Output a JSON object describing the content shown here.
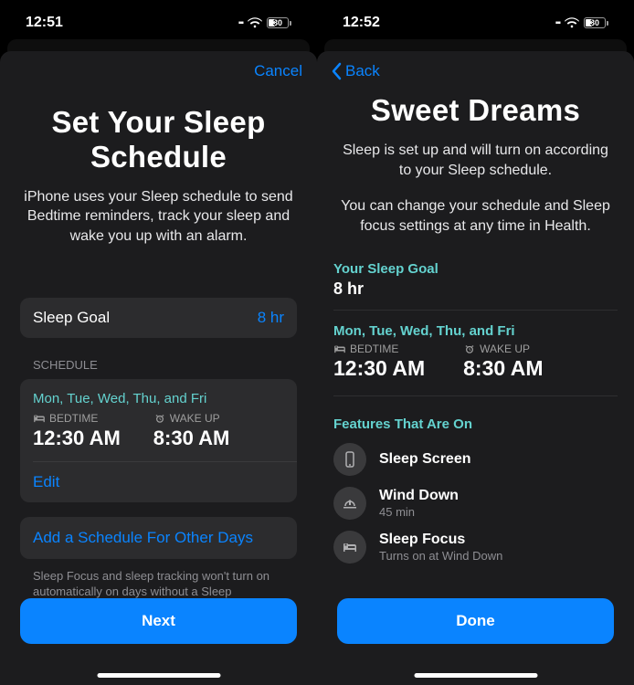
{
  "left": {
    "status_time": "12:51",
    "battery": "30",
    "cancel": "Cancel",
    "title_line1": "Set Your Sleep",
    "title_line2": "Schedule",
    "subtitle": "iPhone uses your Sleep schedule to send Bedtime reminders, track your sleep and wake you up with an alarm.",
    "sleep_goal_label": "Sleep Goal",
    "sleep_goal_value": "8 hr",
    "schedule_header": "SCHEDULE",
    "days": "Mon, Tue, Wed, Thu, and Fri",
    "bedtime_label": "BEDTIME",
    "bedtime_value": "12:30 AM",
    "wakeup_label": "WAKE UP",
    "wakeup_value": "8:30 AM",
    "edit": "Edit",
    "add_schedule": "Add a Schedule For Other Days",
    "footer": "Sleep Focus and sleep tracking won't turn on automatically on days without a Sleep schedule.",
    "next": "Next"
  },
  "right": {
    "status_time": "12:52",
    "battery": "30",
    "back": "Back",
    "title": "Sweet Dreams",
    "subtitle1": "Sleep is set up and will turn on according to your Sleep schedule.",
    "subtitle2": "You can change your schedule and Sleep focus settings at any time in Health.",
    "goal_label": "Your Sleep Goal",
    "goal_value": "8 hr",
    "days": "Mon, Tue, Wed, Thu, and Fri",
    "bedtime_label": "BEDTIME",
    "bedtime_value": "12:30 AM",
    "wakeup_label": "WAKE UP",
    "wakeup_value": "8:30 AM",
    "features_label": "Features That Are On",
    "features": [
      {
        "title": "Sleep Screen",
        "sub": ""
      },
      {
        "title": "Wind Down",
        "sub": "45 min"
      },
      {
        "title": "Sleep Focus",
        "sub": "Turns on at Wind Down"
      }
    ],
    "done": "Done"
  }
}
